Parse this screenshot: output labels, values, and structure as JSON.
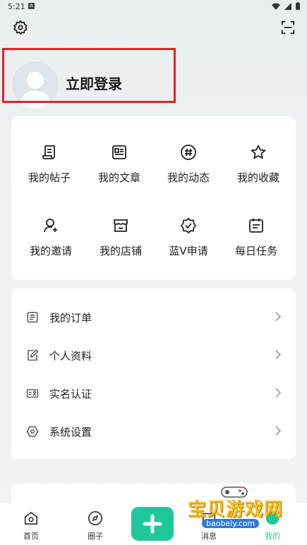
{
  "status_bar": {
    "time": "5:21",
    "notification_letter": "A"
  },
  "header": {
    "settings_icon": "gear-icon",
    "scan_icon": "scan-icon"
  },
  "profile": {
    "login_text": "立即登录"
  },
  "grid": [
    {
      "label": "我的帖子",
      "icon": "scroll-icon"
    },
    {
      "label": "我的文章",
      "icon": "article-icon"
    },
    {
      "label": "我的动态",
      "icon": "hashtag-icon"
    },
    {
      "label": "我的收藏",
      "icon": "star-icon"
    },
    {
      "label": "我的邀请",
      "icon": "user-add-icon"
    },
    {
      "label": "我的店铺",
      "icon": "store-icon"
    },
    {
      "label": "蓝V申请",
      "icon": "badge-check-icon"
    },
    {
      "label": "每日任务",
      "icon": "calendar-list-icon"
    }
  ],
  "menu": [
    {
      "label": "我的订单",
      "icon": "order-icon"
    },
    {
      "label": "个人资料",
      "icon": "edit-doc-icon"
    },
    {
      "label": "实名认证",
      "icon": "id-card-icon"
    },
    {
      "label": "系统设置",
      "icon": "hexagon-settings-icon"
    }
  ],
  "tabbar": {
    "home": "首页",
    "circle": "圈子",
    "messages": "消息",
    "mine": "我的"
  },
  "watermark": {
    "title": "宝贝游戏网",
    "url": "baobeiy.com"
  },
  "colors": {
    "accent": "#1fc89a",
    "highlight_border": "#e0232a"
  }
}
